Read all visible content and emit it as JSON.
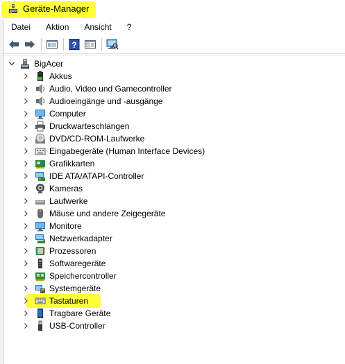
{
  "window": {
    "title": "Geräte-Manager",
    "title_icon": "device-manager-icon"
  },
  "menu": {
    "items": [
      "Datei",
      "Aktion",
      "Ansicht",
      "?"
    ]
  },
  "toolbar": {
    "buttons": [
      "back-arrow-icon",
      "forward-arrow-icon",
      "show-hide-console-tree-icon",
      "help-icon",
      "properties-icon",
      "scan-hardware-icon"
    ]
  },
  "tree": {
    "root": {
      "label": "BigAcer",
      "icon": "computer-tower-icon",
      "expanded": true
    },
    "items": [
      {
        "label": "Akkus",
        "icon": "battery-icon"
      },
      {
        "label": "Audio, Video und Gamecontroller",
        "icon": "speaker-icon"
      },
      {
        "label": "Audioeingänge und -ausgänge",
        "icon": "speaker-icon"
      },
      {
        "label": "Computer",
        "icon": "monitor-icon"
      },
      {
        "label": "Druckwarteschlangen",
        "icon": "printer-icon"
      },
      {
        "label": "DVD/CD-ROM-Laufwerke",
        "icon": "disc-drive-icon"
      },
      {
        "label": "Eingabegeräte (Human Interface Devices)",
        "icon": "hid-icon"
      },
      {
        "label": "Grafikkarten",
        "icon": "display-adapter-icon"
      },
      {
        "label": "IDE ATA/ATAPI-Controller",
        "icon": "ide-controller-icon"
      },
      {
        "label": "Kameras",
        "icon": "camera-icon"
      },
      {
        "label": "Laufwerke",
        "icon": "disk-drive-icon"
      },
      {
        "label": "Mäuse und andere Zeigegeräte",
        "icon": "mouse-icon"
      },
      {
        "label": "Monitore",
        "icon": "monitor-icon"
      },
      {
        "label": "Netzwerkadapter",
        "icon": "network-adapter-icon"
      },
      {
        "label": "Prozessoren",
        "icon": "processor-icon"
      },
      {
        "label": "Softwaregeräte",
        "icon": "software-device-icon"
      },
      {
        "label": "Speichercontroller",
        "icon": "storage-controller-icon"
      },
      {
        "label": "Systemgeräte",
        "icon": "system-device-icon"
      },
      {
        "label": "Tastaturen",
        "icon": "keyboard-icon",
        "highlighted": true
      },
      {
        "label": "Tragbare Geräte",
        "icon": "portable-device-icon"
      },
      {
        "label": "USB-Controller",
        "icon": "usb-icon"
      }
    ]
  },
  "colors": {
    "highlight": "#ffff3c",
    "accent": "#1e73c8"
  }
}
